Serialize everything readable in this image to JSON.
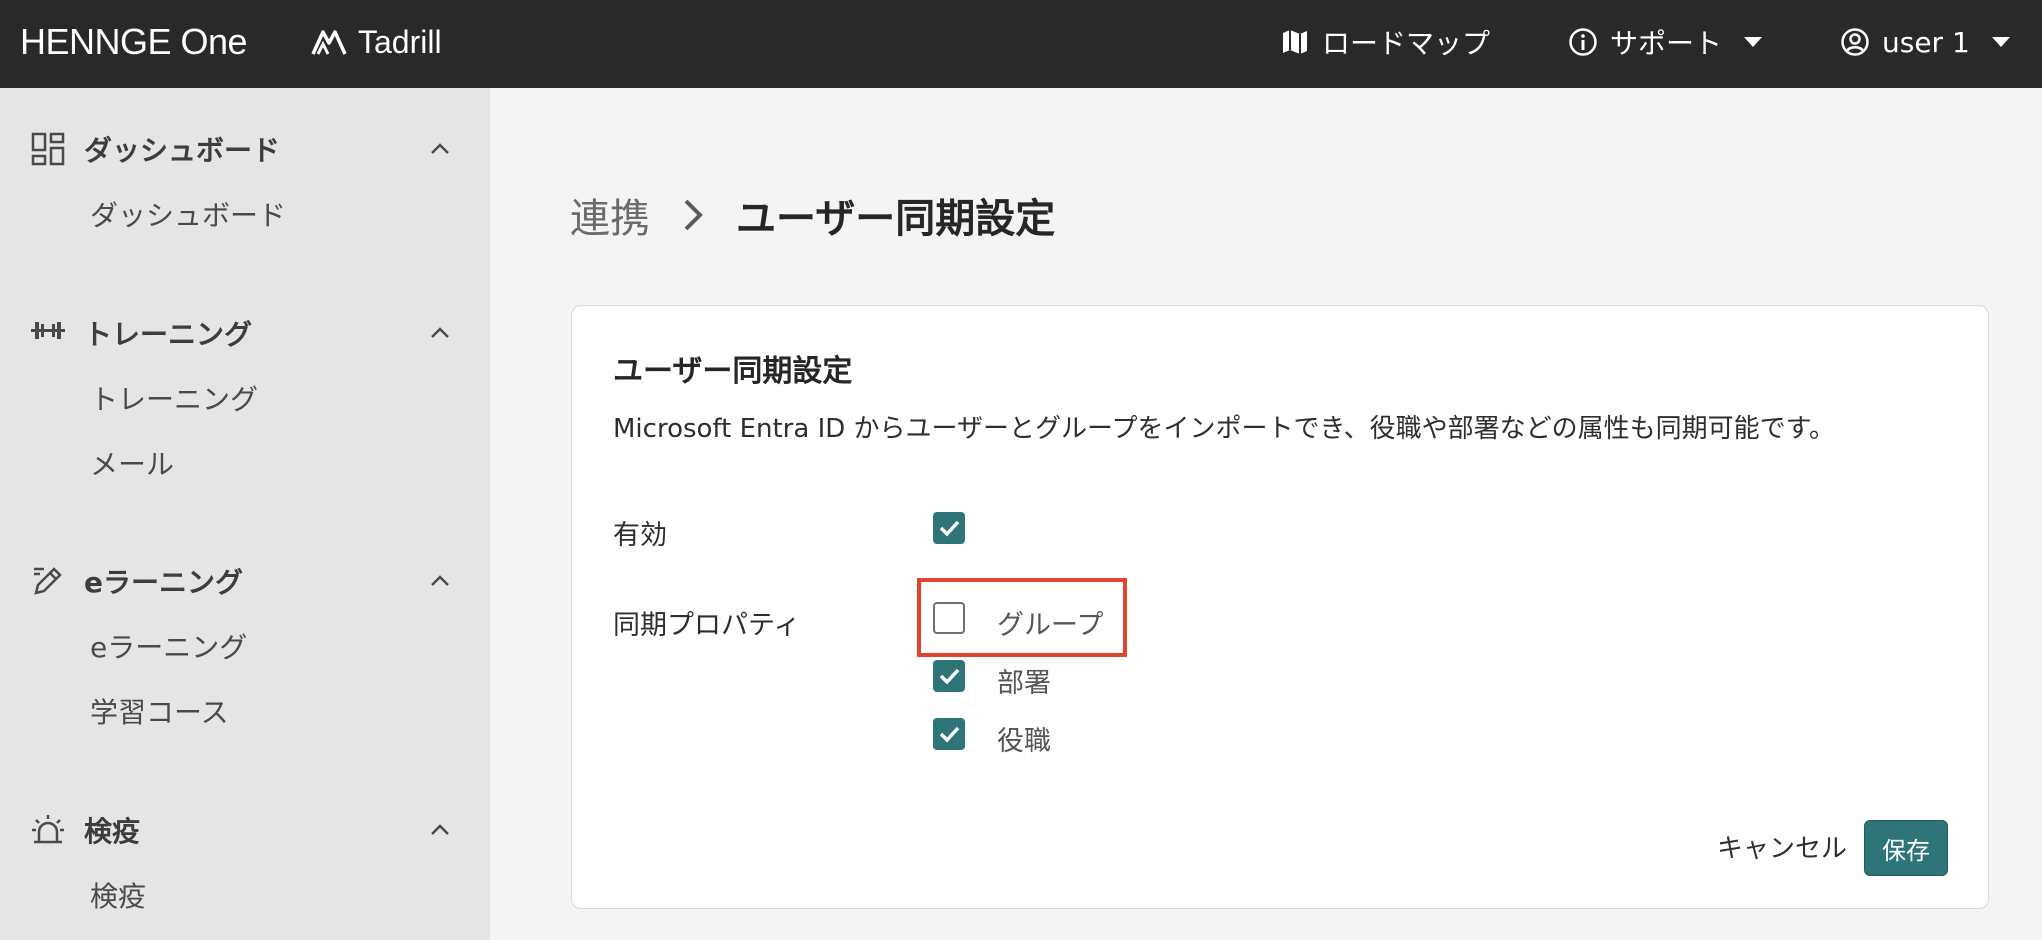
{
  "header": {
    "brand": "HENNGE One",
    "product": "Tadrill",
    "roadmap_label": "ロードマップ",
    "support_label": "サポート",
    "user_label": "user 1"
  },
  "sidebar": {
    "sections": [
      {
        "title": "ダッシュボード",
        "icon": "dashboard-icon",
        "items": [
          "ダッシュボード"
        ]
      },
      {
        "title": "トレーニング",
        "icon": "dumbbell-icon",
        "items": [
          "トレーニング",
          "メール"
        ]
      },
      {
        "title": "eラーニング",
        "icon": "pencil-icon",
        "items": [
          "eラーニング",
          "学習コース"
        ]
      },
      {
        "title": "検疫",
        "icon": "siren-icon",
        "items": [
          "検疫"
        ]
      }
    ]
  },
  "breadcrumb": {
    "parent": "連携",
    "current": "ユーザー同期設定"
  },
  "card": {
    "title": "ユーザー同期設定",
    "description": "Microsoft Entra ID からユーザーとグループをインポートでき、役職や部署などの属性も同期可能です。",
    "enabled_label": "有効",
    "enabled_checked": true,
    "sync_props_label": "同期プロパティ",
    "options": [
      {
        "label": "グループ",
        "checked": false
      },
      {
        "label": "部署",
        "checked": true
      },
      {
        "label": "役職",
        "checked": true
      }
    ],
    "cancel_label": "キャンセル",
    "save_label": "保存"
  },
  "colors": {
    "topbar": "#282928",
    "sidebar": "#e4e5e4",
    "accent": "#2e7578",
    "highlight": "#e2452d"
  }
}
